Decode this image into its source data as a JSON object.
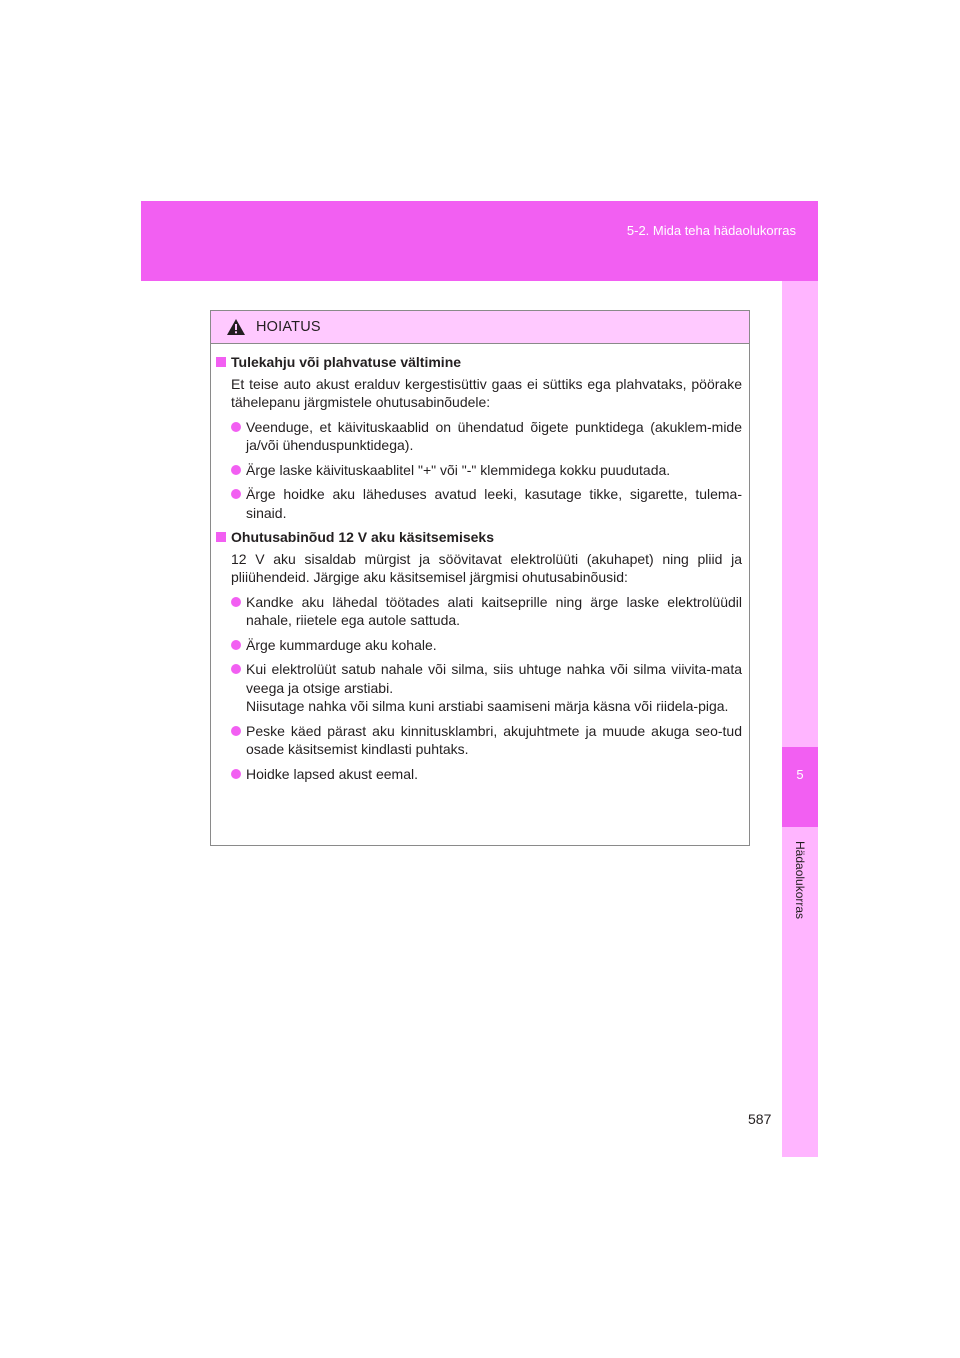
{
  "header": {
    "section": "5-2. Mida teha hädaolukorras"
  },
  "side_tab": {
    "chapter_number": "5",
    "chapter_title": "Hädaolukorras"
  },
  "page_number": "587",
  "warning": {
    "title": "HOIATUS",
    "sections": [
      {
        "heading": "Tulekahju või plahvatuse vältimine",
        "intro": "Et teise auto akust eralduv kergestisüttiv gaas ei süttiks ega plahvataks, pöörake tähelepanu järgmistele ohutusabinõudele:",
        "bullets": [
          "Veenduge, et käivituskaablid on ühendatud õigete punktidega (akuklem-mide ja/või ühenduspunktidega).",
          "Ärge laske käivituskaablitel \"+\" või \"-\" klemmidega kokku puudutada.",
          "Ärge hoidke aku läheduses avatud leeki, kasutage tikke, sigarette, tulema-sinaid."
        ]
      },
      {
        "heading": "Ohutusabinõud 12 V aku käsitsemiseks",
        "intro": "12 V aku sisaldab mürgist ja söövitavat elektrolüüti (akuhapet) ning pliid ja pliiühendeid. Järgige aku käsitsemisel järgmisi ohutusabinõusid:",
        "bullets": [
          "Kandke aku lähedal töötades alati kaitseprille ning ärge laske elektrolüüdil nahale, riietele ega autole sattuda.",
          "Ärge kummarduge aku kohale.",
          "Kui elektrolüüt satub nahale või silma, siis uhtuge nahka või silma viivita-mata veega ja otsige arstiabi.\nNiisutage nahka või silma kuni arstiabi saamiseni märja käsna või riidela-piga.",
          "Peske käed pärast aku kinnitusklambri, akujuhtmete ja muude akuga seo-tud osade käsitsemist kindlasti puhtaks.",
          "Hoidke lapsed akust eemal."
        ]
      }
    ]
  }
}
